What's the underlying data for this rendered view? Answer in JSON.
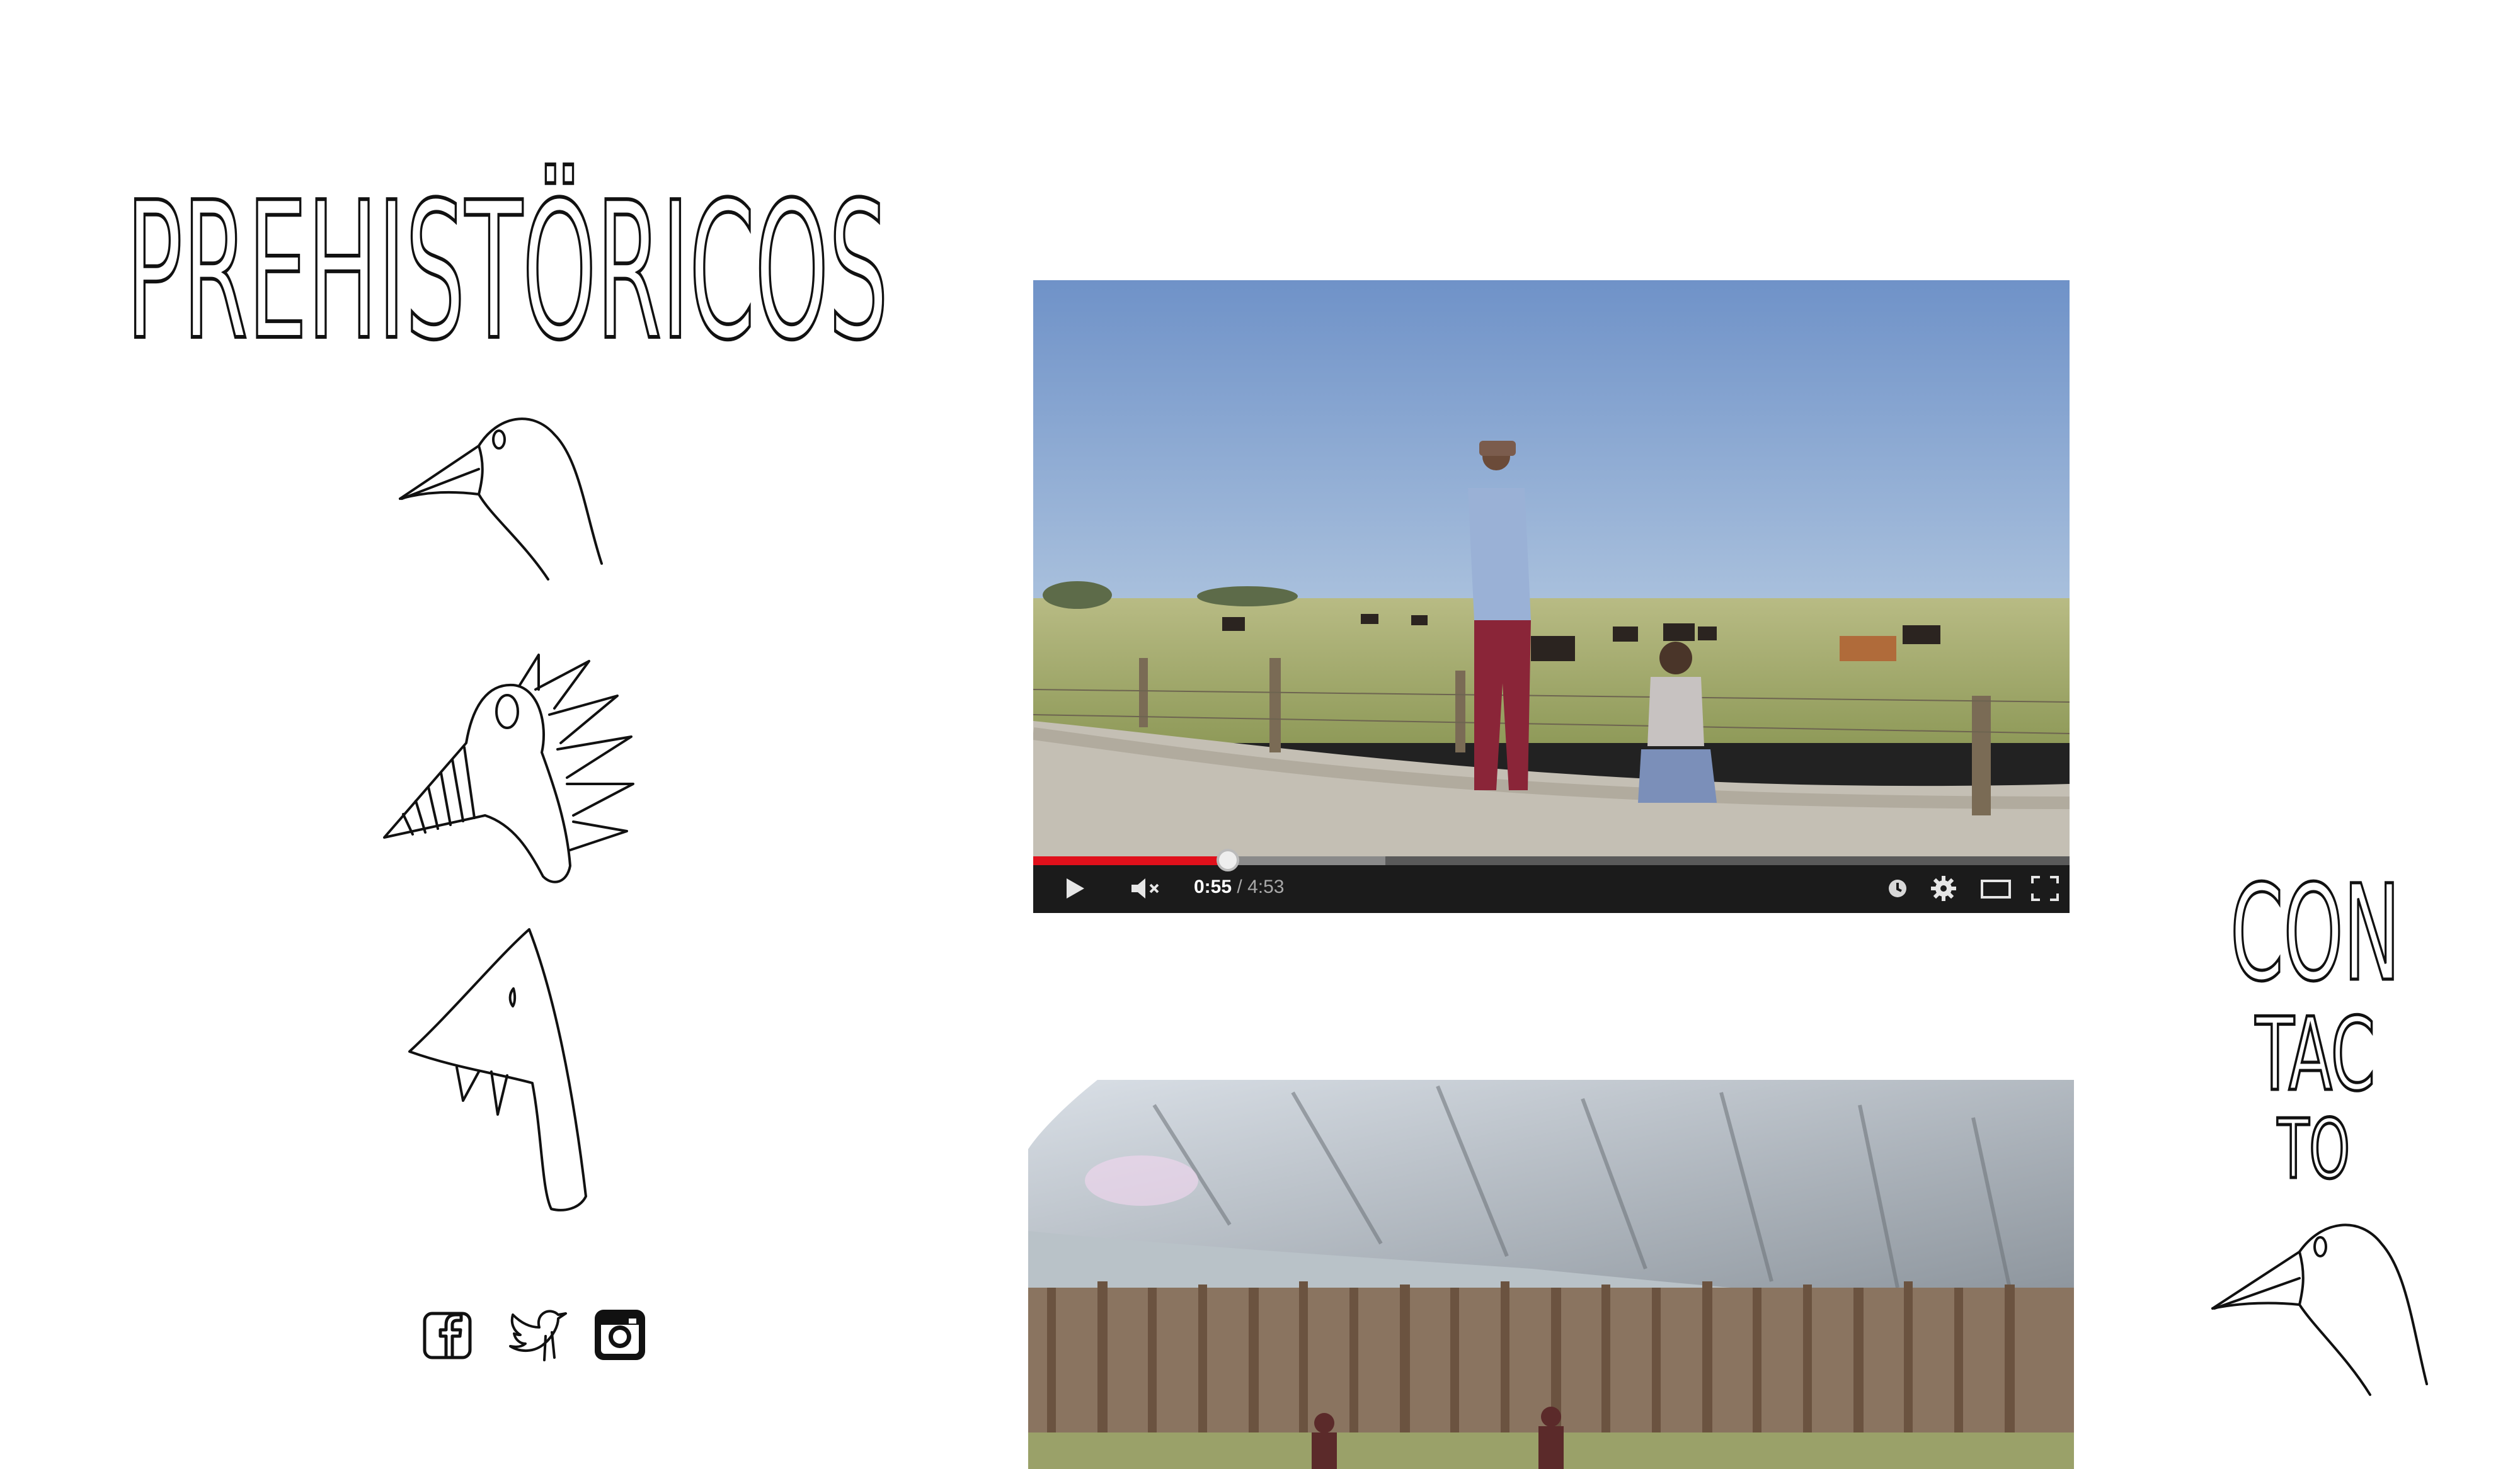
{
  "site": {
    "title": "PREHISTÖRICOS"
  },
  "nav": {
    "creatures": [
      "bird-creature-icon",
      "spiky-creature-icon",
      "fang-creature-icon"
    ]
  },
  "social": {
    "icons": [
      "facebook-icon",
      "twitter-icon",
      "instagram-icon"
    ]
  },
  "video_player": {
    "current_time": "0:55",
    "separator": " / ",
    "duration": "4:53",
    "progress": 0.188,
    "buffered": 0.34,
    "accent_color": "#e0101b",
    "muted": true
  },
  "contact": {
    "line1": "CON",
    "line2": "TAC",
    "line3": "TO"
  }
}
